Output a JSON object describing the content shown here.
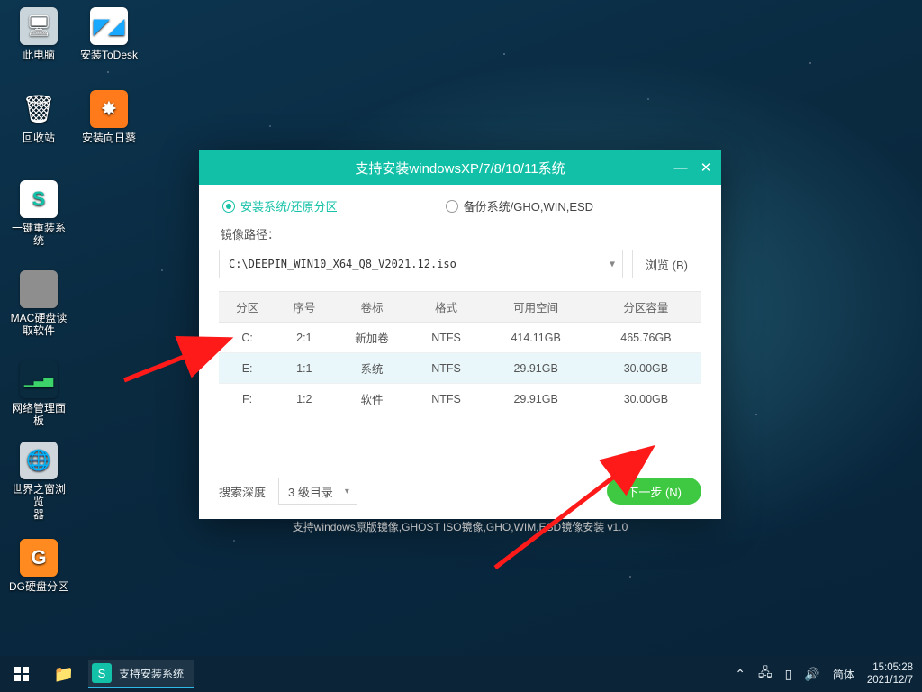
{
  "desktop_icons": [
    {
      "label": "此电脑",
      "bg": "#c9d5da",
      "glyph": "🖥"
    },
    {
      "label": "安装ToDesk",
      "bg": "#ffffff",
      "glyph": "▞",
      "fg": "#19a8ff"
    },
    {
      "label": "回收站",
      "bg": "#4b5d66",
      "glyph": "🗑"
    },
    {
      "label": "安装向日葵",
      "bg": "#ff7a1a",
      "glyph": "✸"
    },
    {
      "label": "一键重装系统",
      "bg": "#ffffff",
      "glyph": "S",
      "fg": "#13c1a8"
    },
    {
      "label": "MAC硬盘读\n取软件",
      "bg": "#8e8e8e",
      "glyph": ""
    },
    {
      "label": "网络管理面板",
      "bg": "#0a2b3d",
      "glyph": "▁▃▅",
      "fg": "#3cd46a"
    },
    {
      "label": "世界之窗浏览\n器",
      "bg": "#cfd7dc",
      "glyph": "🌐"
    },
    {
      "label": "DG硬盘分区",
      "bg": "#ff8a1f",
      "glyph": "G"
    }
  ],
  "window": {
    "title": "支持安装windowsXP/7/8/10/11系统",
    "radio_install": "安装系统/还原分区",
    "radio_backup": "备份系统/GHO,WIN,ESD",
    "path_label": "镜像路径：",
    "path_value": "C:\\DEEPIN_WIN10_X64_Q8_V2021.12.iso",
    "browse": "浏览 (B)",
    "cols": {
      "part": "分区",
      "idx": "序号",
      "vol": "卷标",
      "fmt": "格式",
      "free": "可用空间",
      "cap": "分区容量"
    },
    "rows": [
      {
        "part": "C:",
        "idx": "2:1",
        "vol": "新加卷",
        "fmt": "NTFS",
        "free": "414.11GB",
        "cap": "465.76GB",
        "sel": false
      },
      {
        "part": "E:",
        "idx": "1:1",
        "vol": "系统",
        "fmt": "NTFS",
        "free": "29.91GB",
        "cap": "30.00GB",
        "sel": true
      },
      {
        "part": "F:",
        "idx": "1:2",
        "vol": "软件",
        "fmt": "NTFS",
        "free": "29.91GB",
        "cap": "30.00GB",
        "sel": false
      }
    ],
    "depth_label": "搜索深度",
    "depth_value": "3 级目录",
    "next": "下一步 (N)",
    "hint": "支持windows原版镜像,GHOST ISO镜像,GHO,WIM,ESD镜像安装     v1.0"
  },
  "taskbar": {
    "app_label": "支持安装系统",
    "ime": "简体",
    "time": "15:05:28",
    "date": "2021/12/7"
  }
}
